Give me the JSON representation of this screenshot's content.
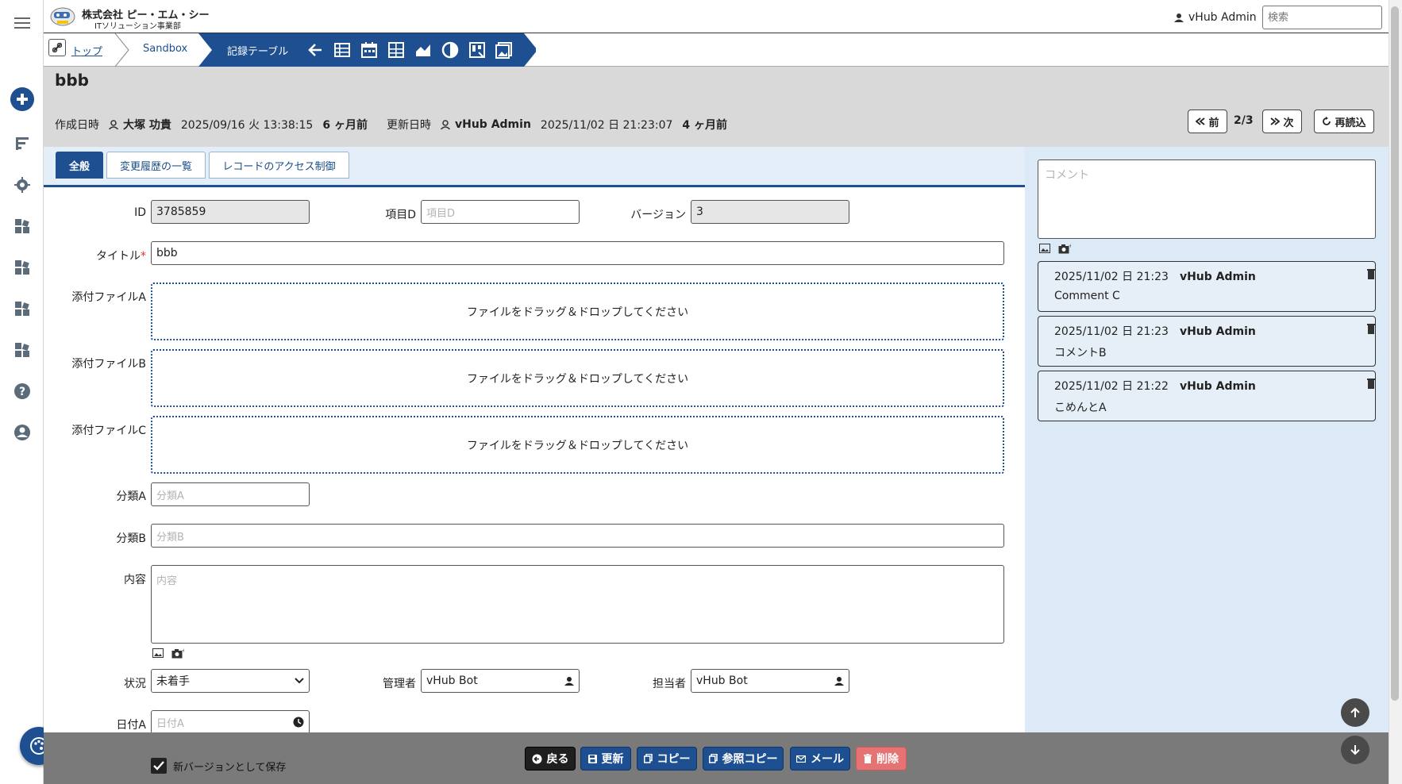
{
  "header": {
    "company_line1": "株式会社 ピー・エム・シー",
    "company_line2": "ITソリューション事業部",
    "user": "vHub Admin",
    "search_placeholder": "検索"
  },
  "breadcrumb": {
    "top": "トップ",
    "sandbox": "Sandbox",
    "table": "記録テーブル"
  },
  "record": {
    "title": "bbb",
    "created_label": "作成日時",
    "created_by": "大塚 功貴",
    "created_at": "2025/09/16 火 13:38:15",
    "created_ago": "6 ヶ月前",
    "updated_label": "更新日時",
    "updated_by": "vHub Admin",
    "updated_at": "2025/11/02 日 21:23:07",
    "updated_ago": "4 ヶ月前",
    "prev_label": "前",
    "next_label": "次",
    "page": "2/3",
    "reload_label": "再読込"
  },
  "tabs": {
    "general": "全般",
    "history": "変更履歴の一覧",
    "access": "レコードのアクセス制御"
  },
  "form": {
    "id_label": "ID",
    "id_value": "3785859",
    "itemd_label": "項目D",
    "itemd_placeholder": "項目D",
    "version_label": "バージョン",
    "version_value": "3",
    "title_label": "タイトル",
    "title_required": "*",
    "title_value": "bbb",
    "attachA_label": "添付ファイルA",
    "attachB_label": "添付ファイルB",
    "attachC_label": "添付ファイルC",
    "drop_text": "ファイルをドラッグ＆ドロップしてください",
    "classA_label": "分類A",
    "classA_placeholder": "分類A",
    "classB_label": "分類B",
    "classB_placeholder": "分類B",
    "content_label": "内容",
    "content_placeholder": "内容",
    "status_label": "状況",
    "status_value": "未着手",
    "manager_label": "管理者",
    "manager_value": "vHub Bot",
    "owner_label": "担当者",
    "owner_value": "vHub Bot",
    "dateA_label": "日付A",
    "dateA_placeholder": "日付A",
    "save_version_label": "新バージョンとして保存"
  },
  "comments": {
    "placeholder": "コメント",
    "items": [
      {
        "time": "2025/11/02 日 21:23",
        "user": "vHub Admin",
        "text": "Comment C"
      },
      {
        "time": "2025/11/02 日 21:23",
        "user": "vHub Admin",
        "text": "コメントB"
      },
      {
        "time": "2025/11/02 日 21:22",
        "user": "vHub Admin",
        "text": "こめんとA"
      }
    ]
  },
  "footer": {
    "back": "戻る",
    "update": "更新",
    "copy": "コピー",
    "ref_copy": "参照コピー",
    "mail": "メール",
    "delete": "削除"
  },
  "colors": {
    "accent": "#1d4f91",
    "panel": "#dce9f7",
    "header_gray": "#d9d9d9",
    "footer_gray": "#7a7a7a",
    "danger": "#e57373"
  }
}
